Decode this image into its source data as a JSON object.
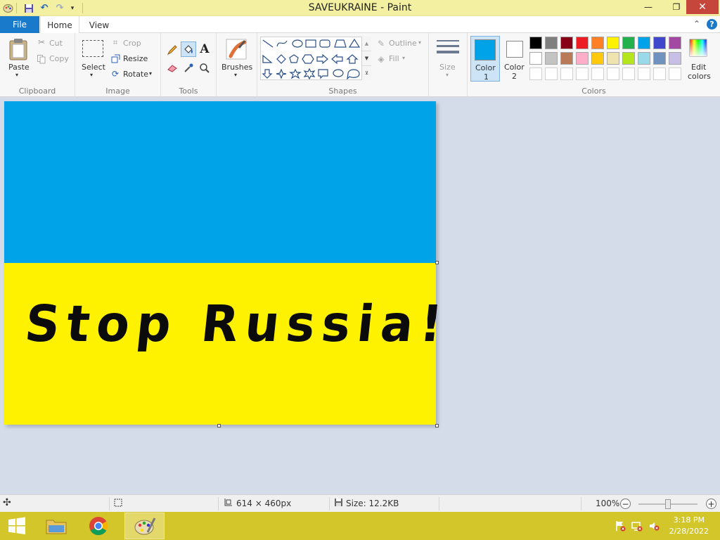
{
  "window": {
    "title": "SAVEUKRAINE - Paint",
    "minimize_glyph": "—",
    "restore_glyph": "❐",
    "close_glyph": "✕"
  },
  "tabs": {
    "file": "File",
    "home": "Home",
    "view": "View"
  },
  "ribbon": {
    "clipboard": {
      "label": "Clipboard",
      "paste": "Paste",
      "cut": "Cut",
      "copy": "Copy"
    },
    "image": {
      "label": "Image",
      "select": "Select",
      "crop": "Crop",
      "resize": "Resize",
      "rotate": "Rotate"
    },
    "tools": {
      "label": "Tools"
    },
    "brushes": {
      "label": "Brushes"
    },
    "shapes": {
      "label": "Shapes",
      "outline": "Outline",
      "fill": "Fill"
    },
    "size": {
      "label": "Size"
    },
    "colors": {
      "label": "Colors",
      "color1": "Color",
      "color1_num": "1",
      "color2": "Color",
      "color2_num": "2",
      "edit": "Edit",
      "edit2": "colors",
      "color1_value": "#00a2e8",
      "color2_value": "#ffffff",
      "palette_row1": [
        "#000000",
        "#7f7f7f",
        "#880015",
        "#ed1c24",
        "#ff7f27",
        "#fff200",
        "#22b14c",
        "#00a2e8",
        "#3f48cc",
        "#a349a4"
      ],
      "palette_row2": [
        "#ffffff",
        "#c3c3c3",
        "#b97a57",
        "#ffaec9",
        "#ffc90e",
        "#efe4b0",
        "#b5e61d",
        "#99d9ea",
        "#7092be",
        "#c8bfe7"
      ]
    }
  },
  "canvas": {
    "top_color": "#00a2e8",
    "bottom_color": "#fff200",
    "text": "Stop Russia!"
  },
  "status": {
    "dimensions": "614 × 460px",
    "size": "Size: 12.2KB",
    "zoom": "100%"
  },
  "taskbar": {
    "time": "3:18 PM",
    "date": "2/28/2022"
  }
}
